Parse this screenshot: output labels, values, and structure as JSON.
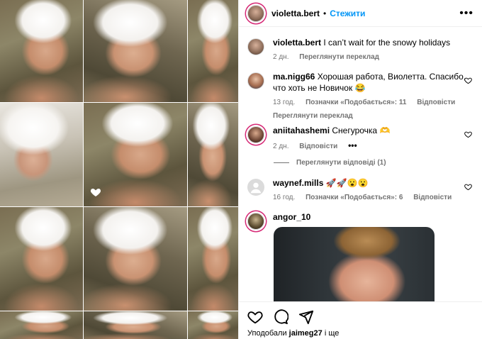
{
  "post": {
    "author": "violetta.bert",
    "follow_label": "Стежити",
    "more_label": "•••"
  },
  "caption": {
    "username": "violetta.bert",
    "text": "I can’t wait for the snowy holidays",
    "time": "2 дн.",
    "translate": "Переглянути переклад"
  },
  "comments": [
    {
      "username": "ma.nigg66",
      "text": "Хорошая работа, Виолетта. Спасибо, что хоть не Новичок 😂",
      "time": "13 год.",
      "likes": "Позначки «Подобається»: 11",
      "reply": "Відповісти",
      "translate": "Переглянути переклад"
    },
    {
      "username": "aniitahashemi",
      "text": "Снегурочка 🫶",
      "time": "2 дн.",
      "reply": "Відповісти",
      "more": "•••"
    },
    {
      "username": "waynef.mills",
      "text": "🚀🚀😮😮",
      "time": "16 год.",
      "likes": "Позначки «Подобається»: 6",
      "reply": "Відповісти"
    },
    {
      "username": "angor_10"
    }
  ],
  "view_replies": "Переглянути відповіді (1)",
  "footer": {
    "liked_by_prefix": "Уподобали",
    "liked_by_user": "jaimeg27",
    "liked_by_suffix": "і ще"
  },
  "icons": {
    "like": "heart-icon",
    "comment": "comment-icon",
    "share": "share-icon",
    "media_like": "heart-icon"
  },
  "colors": {
    "accent": "#0095f6",
    "muted": "#737373"
  }
}
